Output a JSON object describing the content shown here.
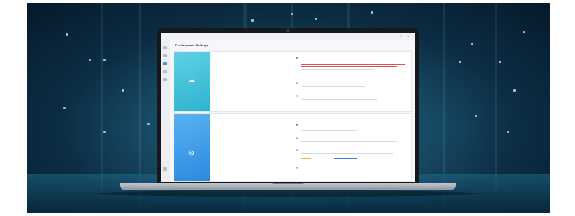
{
  "window": {
    "app_name": "",
    "controls": [
      "–",
      "□",
      "×"
    ]
  },
  "page": {
    "title": "Performance Settings"
  },
  "sidebar": {
    "icons": [
      "home-icon",
      "cloud-icon",
      "settings-icon",
      "profile-icon",
      "apps-icon",
      "help-icon"
    ]
  },
  "sections": [
    {
      "title": "",
      "description": "",
      "hero_icon": "cloud-icon",
      "options": [
        {
          "label": "",
          "selected": true
        },
        {
          "label": "",
          "selected": false
        },
        {
          "label": "",
          "selected": false
        }
      ]
    },
    {
      "title": "",
      "description": "",
      "hero_icon": "gear-icon",
      "options": [
        {
          "label": "",
          "selected": true
        },
        {
          "label": "",
          "selected": false
        },
        {
          "label": "",
          "selected": false
        },
        {
          "label": "",
          "selected": false
        }
      ]
    }
  ],
  "colors": {
    "accent": "#3d7fe0",
    "warning": "#e55050",
    "slider": "#f2b233",
    "hero_top": "#2fb3cf",
    "hero_bottom": "#2c89e0"
  }
}
